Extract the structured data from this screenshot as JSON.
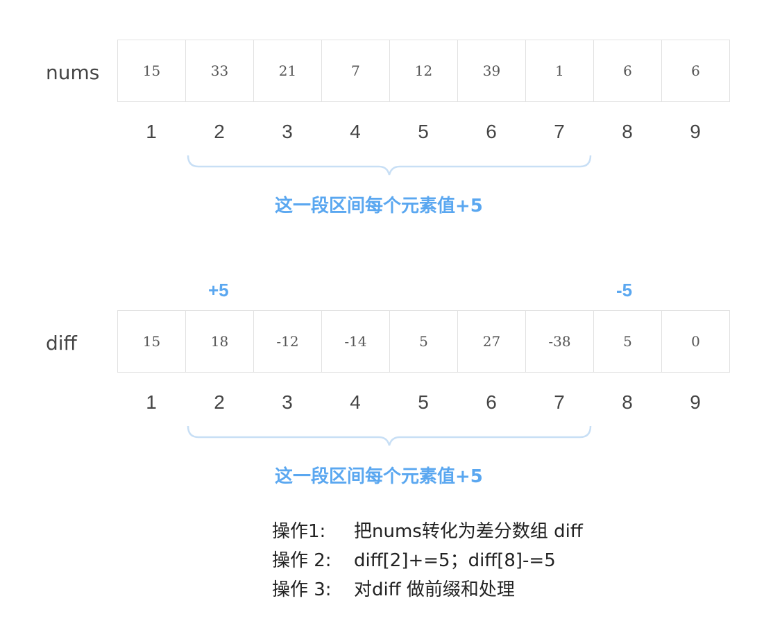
{
  "nums": {
    "label": "nums",
    "values": [
      "15",
      "33",
      "21",
      "7",
      "12",
      "39",
      "1",
      "6",
      "6"
    ],
    "indices": [
      "1",
      "2",
      "3",
      "4",
      "5",
      "6",
      "7",
      "8",
      "9"
    ],
    "note": "这一段区间每个元素值+5"
  },
  "diff": {
    "label": "diff",
    "values": [
      "15",
      "18",
      "-12",
      "-14",
      "5",
      "27",
      "-38",
      "5",
      "0"
    ],
    "indices": [
      "1",
      "2",
      "3",
      "4",
      "5",
      "6",
      "7",
      "8",
      "9"
    ],
    "note": "这一段区间每个元素值+5",
    "plus_mark": "+5",
    "minus_mark": "-5"
  },
  "operations": [
    {
      "label": "操作1:",
      "text": "把nums转化为差分数组 diff"
    },
    {
      "label": "操作 2:",
      "text": "diff[2]+=5；diff[8]-=5"
    },
    {
      "label": "操作 3:",
      "text": "对diff 做前缀和处理"
    }
  ],
  "colors": {
    "accent": "#5aa7f0",
    "grid": "#e2e2e2"
  }
}
